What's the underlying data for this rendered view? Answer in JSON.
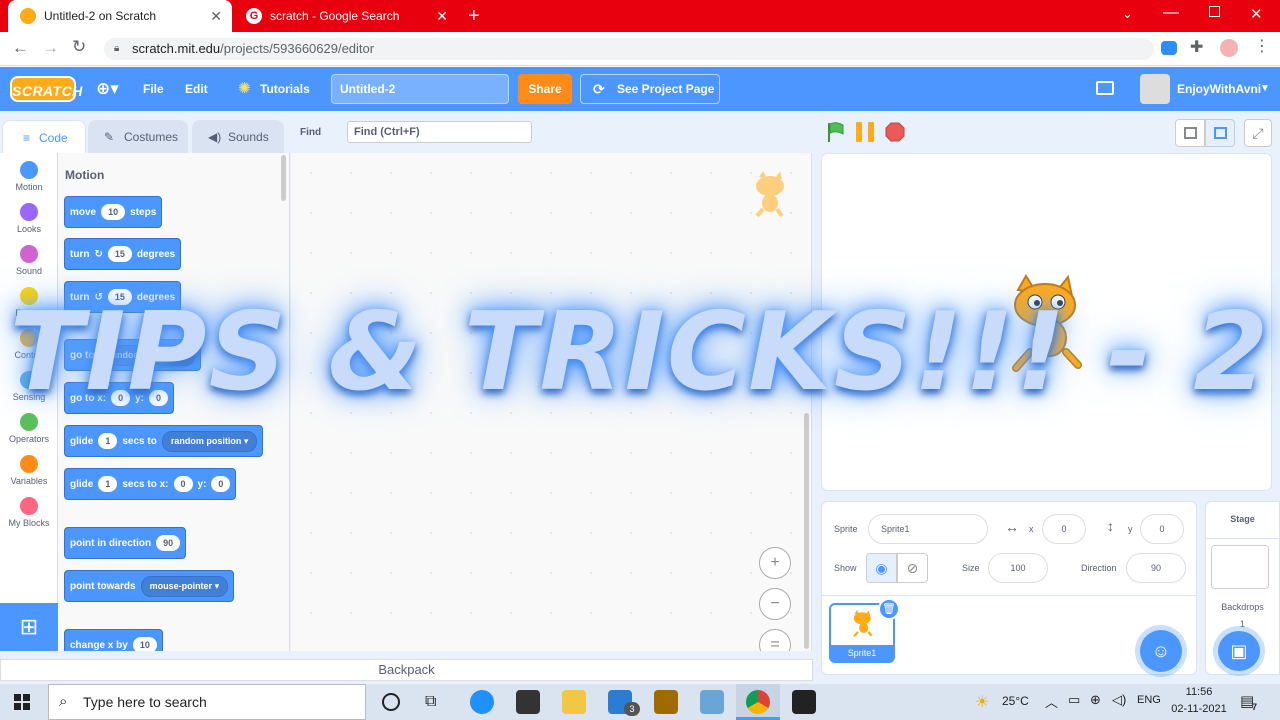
{
  "browser": {
    "tabs": [
      {
        "title": "Untitled-2 on Scratch",
        "active": true
      },
      {
        "title": "scratch - Google Search",
        "active": false
      }
    ],
    "url_host": "scratch.mit.edu",
    "url_path": "/projects/593660629/editor"
  },
  "menubar": {
    "logo": "SCRATCH",
    "file": "File",
    "edit": "Edit",
    "tutorials": "Tutorials",
    "project_title": "Untitled-2",
    "share": "Share",
    "see_project_page": "See Project Page",
    "username": "EnjoyWithAvni"
  },
  "editor_tabs": {
    "code": "Code",
    "costumes": "Costumes",
    "sounds": "Sounds"
  },
  "find": {
    "label": "Find",
    "placeholder": "Find (Ctrl+F)"
  },
  "categories": [
    {
      "label": "Motion",
      "color": "#4c97ff"
    },
    {
      "label": "Looks",
      "color": "#9966ff"
    },
    {
      "label": "Sound",
      "color": "#cf63cf"
    },
    {
      "label": "Events",
      "color": "#ffd500"
    },
    {
      "label": "Control",
      "color": "#ffab19"
    },
    {
      "label": "Sensing",
      "color": "#5cb1d6"
    },
    {
      "label": "Operators",
      "color": "#59c059"
    },
    {
      "label": "Variables",
      "color": "#ff8c1a"
    },
    {
      "label": "My Blocks",
      "color": "#ff6680"
    }
  ],
  "palette": {
    "heading": "Motion",
    "move": {
      "a": "move",
      "v": "10",
      "b": "steps"
    },
    "turn_right": {
      "a": "turn",
      "v": "15",
      "b": "degrees"
    },
    "turn_left": {
      "a": "turn",
      "v": "15",
      "b": "degrees"
    },
    "go_to": {
      "a": "go to",
      "d": "random position"
    },
    "go_to_xy": {
      "a": "go to x:",
      "x": "0",
      "y_label": "y:",
      "y": "0"
    },
    "glide_to": {
      "a": "glide",
      "v": "1",
      "b": "secs to",
      "d": "random position"
    },
    "glide_xy": {
      "a": "glide",
      "v": "1",
      "b": "secs to x:",
      "x": "0",
      "y_label": "y:",
      "y": "0"
    },
    "point_dir": {
      "a": "point in direction",
      "v": "90"
    },
    "point_towards": {
      "a": "point towards",
      "d": "mouse-pointer"
    },
    "change_x": {
      "a": "change x by",
      "v": "10"
    }
  },
  "zoom": {
    "in": "+",
    "out": "−",
    "reset": "="
  },
  "backpack": "Backpack",
  "overlay": "TIPS & TRICKS!!! - 2",
  "sprite_info": {
    "sprite_label": "Sprite",
    "sprite_name": "Sprite1",
    "x_label": "x",
    "x": "0",
    "y_label": "y",
    "y": "0",
    "show_label": "Show",
    "size_label": "Size",
    "size": "100",
    "direction_label": "Direction",
    "direction": "90"
  },
  "sprite_thumb_name": "Sprite1",
  "stage_panel": {
    "title": "Stage",
    "backdrops_label": "Backdrops",
    "backdrops_count": "1"
  },
  "taskbar": {
    "search_placeholder": "Type here to search",
    "weather": "25°C",
    "lang": "ENG",
    "time": "11:56",
    "date": "02-11-2021",
    "notif_count": "7",
    "mail_badge": "3"
  }
}
